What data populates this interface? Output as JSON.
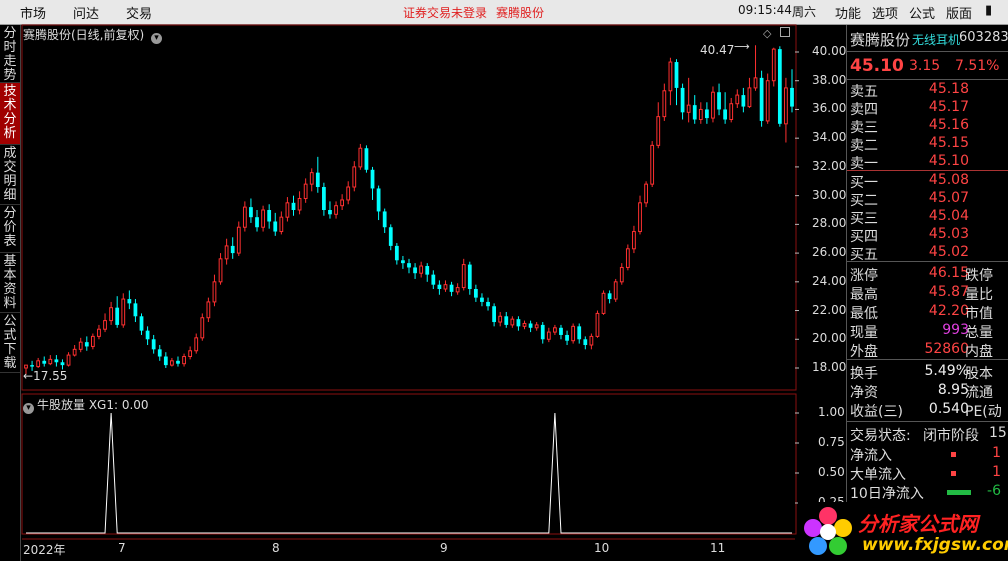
{
  "topbar": {
    "menu": [
      "市场",
      "问达",
      "交易"
    ],
    "status": "证券交易未登录",
    "stock": "赛腾股份",
    "time": "09:15:44",
    "weekday": "周六",
    "right_menu": [
      "功能",
      "选项",
      "公式",
      "版面"
    ]
  },
  "left_nav": [
    "分时走势",
    "技术分析",
    "成交明细",
    "分价表",
    "基本资料",
    "公式下载"
  ],
  "chart": {
    "title": "赛腾股份(日线,前复权)",
    "high_mark": "40.47",
    "low_mark": "←17.55",
    "price_ticks": [
      "40.00",
      "38.00",
      "36.00",
      "34.00",
      "32.00",
      "30.00",
      "28.00",
      "26.00",
      "24.00",
      "22.00",
      "20.00",
      "18.00"
    ],
    "indicator_title": "牛股放量 XG1: 0.00",
    "indicator_ticks": [
      "1.00",
      "0.75",
      "0.50",
      "0.25"
    ],
    "date_labels": [
      "2022年",
      "7",
      "8",
      "9",
      "10",
      "11"
    ]
  },
  "chart_data": {
    "type": "candlestick",
    "title": "赛腾股份(日线,前复权)",
    "ylim": [
      17,
      41
    ],
    "candles": [
      [
        18.0,
        18.2,
        18.2,
        17.55
      ],
      [
        18.2,
        18.1,
        18.5,
        17.8
      ],
      [
        18.1,
        18.5,
        18.7,
        18.0
      ],
      [
        18.5,
        18.3,
        18.8,
        18.1
      ],
      [
        18.3,
        18.6,
        18.9,
        18.2
      ],
      [
        18.6,
        18.4,
        18.9,
        18.1
      ],
      [
        18.4,
        18.2,
        18.6,
        17.9
      ],
      [
        18.2,
        18.9,
        19.1,
        18.1
      ],
      [
        18.9,
        19.3,
        19.6,
        18.8
      ],
      [
        19.3,
        19.8,
        20.1,
        19.1
      ],
      [
        19.8,
        19.5,
        20.2,
        19.2
      ],
      [
        19.5,
        20.2,
        20.4,
        19.3
      ],
      [
        20.2,
        20.7,
        21.0,
        20.0
      ],
      [
        20.7,
        21.3,
        21.8,
        20.5
      ],
      [
        21.3,
        22.2,
        22.6,
        21.0
      ],
      [
        22.2,
        21.0,
        23.0,
        20.8
      ],
      [
        21.0,
        22.8,
        23.2,
        20.8
      ],
      [
        22.8,
        22.5,
        23.4,
        22.1
      ],
      [
        22.5,
        21.6,
        22.8,
        21.2
      ],
      [
        21.6,
        20.6,
        21.8,
        20.3
      ],
      [
        20.6,
        20.0,
        20.9,
        19.6
      ],
      [
        20.0,
        19.3,
        20.3,
        19.0
      ],
      [
        19.3,
        18.8,
        19.6,
        18.5
      ],
      [
        18.8,
        18.2,
        19.1,
        18.0
      ],
      [
        18.2,
        18.5,
        18.7,
        18.1
      ],
      [
        18.5,
        18.3,
        18.8,
        18.1
      ],
      [
        18.3,
        18.8,
        19.0,
        18.1
      ],
      [
        18.8,
        19.2,
        19.5,
        18.6
      ],
      [
        19.2,
        20.1,
        20.4,
        19.0
      ],
      [
        20.1,
        21.5,
        21.8,
        19.9
      ],
      [
        21.5,
        22.6,
        22.9,
        21.2
      ],
      [
        22.6,
        24.0,
        24.5,
        22.3
      ],
      [
        24.0,
        25.6,
        26.0,
        23.8
      ],
      [
        25.6,
        26.5,
        27.0,
        25.2
      ],
      [
        26.5,
        26.0,
        27.1,
        25.6
      ],
      [
        26.0,
        27.8,
        28.2,
        25.8
      ],
      [
        27.8,
        29.2,
        29.6,
        27.5
      ],
      [
        29.2,
        28.5,
        29.8,
        28.1
      ],
      [
        28.5,
        27.8,
        29.0,
        27.5
      ],
      [
        27.8,
        29.0,
        29.3,
        27.5
      ],
      [
        29.0,
        28.2,
        29.4,
        27.7
      ],
      [
        28.2,
        27.5,
        28.8,
        27.2
      ],
      [
        27.5,
        28.5,
        28.9,
        27.3
      ],
      [
        28.5,
        29.5,
        29.9,
        28.2
      ],
      [
        29.5,
        29.0,
        30.0,
        28.6
      ],
      [
        29.0,
        29.8,
        30.3,
        28.7
      ],
      [
        29.8,
        30.8,
        31.2,
        29.5
      ],
      [
        30.8,
        31.6,
        31.9,
        30.3
      ],
      [
        31.6,
        30.6,
        32.7,
        30.2
      ],
      [
        30.6,
        29.0,
        30.9,
        28.6
      ],
      [
        29.0,
        28.7,
        29.6,
        28.4
      ],
      [
        28.7,
        29.3,
        29.6,
        28.4
      ],
      [
        29.3,
        29.7,
        30.1,
        29.0
      ],
      [
        29.7,
        30.6,
        31.0,
        29.4
      ],
      [
        30.6,
        32.0,
        32.4,
        30.3
      ],
      [
        32.0,
        33.3,
        33.6,
        31.8
      ],
      [
        33.3,
        31.8,
        33.5,
        31.6
      ],
      [
        31.8,
        30.5,
        32.0,
        29.7
      ],
      [
        30.5,
        28.9,
        30.7,
        28.3
      ],
      [
        28.9,
        27.8,
        29.1,
        27.4
      ],
      [
        27.8,
        26.5,
        28.0,
        26.2
      ],
      [
        26.5,
        25.5,
        26.7,
        25.2
      ],
      [
        25.5,
        25.3,
        25.8,
        24.9
      ],
      [
        25.3,
        25.0,
        25.6,
        24.6
      ],
      [
        25.0,
        24.6,
        25.3,
        24.2
      ],
      [
        24.6,
        25.1,
        25.4,
        24.3
      ],
      [
        25.1,
        24.5,
        25.3,
        24.0
      ],
      [
        24.5,
        23.8,
        24.8,
        23.5
      ],
      [
        23.8,
        23.5,
        24.1,
        23.1
      ],
      [
        23.5,
        23.8,
        24.1,
        23.3
      ],
      [
        23.8,
        23.3,
        24.0,
        23.0
      ],
      [
        23.3,
        23.6,
        23.9,
        23.1
      ],
      [
        23.6,
        25.2,
        25.6,
        23.4
      ],
      [
        25.2,
        23.5,
        25.4,
        23.1
      ],
      [
        23.5,
        22.9,
        23.8,
        22.6
      ],
      [
        22.9,
        22.6,
        23.2,
        22.3
      ],
      [
        22.6,
        22.3,
        22.9,
        22.0
      ],
      [
        22.3,
        21.2,
        22.5,
        20.9
      ],
      [
        21.2,
        21.6,
        21.9,
        20.9
      ],
      [
        21.6,
        21.0,
        21.9,
        20.8
      ],
      [
        21.0,
        21.4,
        21.6,
        20.8
      ],
      [
        21.4,
        20.9,
        21.6,
        20.6
      ],
      [
        20.9,
        21.1,
        21.3,
        20.7
      ],
      [
        21.1,
        20.8,
        21.3,
        20.5
      ],
      [
        20.8,
        21.0,
        21.2,
        20.6
      ],
      [
        21.0,
        20.0,
        21.2,
        19.7
      ],
      [
        20.0,
        20.5,
        20.8,
        19.8
      ],
      [
        20.5,
        20.8,
        21.0,
        20.3
      ],
      [
        20.8,
        20.3,
        21.0,
        20.0
      ],
      [
        20.3,
        19.9,
        20.6,
        19.6
      ],
      [
        19.9,
        20.9,
        21.1,
        19.7
      ],
      [
        20.9,
        20.0,
        21.1,
        19.7
      ],
      [
        20.0,
        19.6,
        20.2,
        19.3
      ],
      [
        19.6,
        20.2,
        20.4,
        19.3
      ],
      [
        20.2,
        21.8,
        22.0,
        20.1
      ],
      [
        21.8,
        23.2,
        23.4,
        21.7
      ],
      [
        23.2,
        22.8,
        23.4,
        22.5
      ],
      [
        22.8,
        24.0,
        24.2,
        22.6
      ],
      [
        24.0,
        25.0,
        25.3,
        23.8
      ],
      [
        25.0,
        26.3,
        26.6,
        24.8
      ],
      [
        26.3,
        27.5,
        27.9,
        26.0
      ],
      [
        27.5,
        29.5,
        30.0,
        27.3
      ],
      [
        29.5,
        30.8,
        31.0,
        29.2
      ],
      [
        30.8,
        33.5,
        33.8,
        30.6
      ],
      [
        33.5,
        35.5,
        36.5,
        33.3
      ],
      [
        35.5,
        37.3,
        37.8,
        35.2
      ],
      [
        37.3,
        39.3,
        39.6,
        36.3
      ],
      [
        39.3,
        37.5,
        39.5,
        36.3
      ],
      [
        37.5,
        35.8,
        37.8,
        35.3
      ],
      [
        35.8,
        36.3,
        38.2,
        35.1
      ],
      [
        36.3,
        35.3,
        37.0,
        35.0
      ],
      [
        35.3,
        36.0,
        36.5,
        35.0
      ],
      [
        36.0,
        35.4,
        36.5,
        35.0
      ],
      [
        35.4,
        37.2,
        37.6,
        35.1
      ],
      [
        37.2,
        36.0,
        37.8,
        35.6
      ],
      [
        36.0,
        35.3,
        37.2,
        35.0
      ],
      [
        35.3,
        36.4,
        36.8,
        35.1
      ],
      [
        36.4,
        37.0,
        37.4,
        36.1
      ],
      [
        37.0,
        36.2,
        37.5,
        35.8
      ],
      [
        36.2,
        37.5,
        38.2,
        36.1
      ],
      [
        37.5,
        38.2,
        40.47,
        37.3
      ],
      [
        38.2,
        35.2,
        38.7,
        34.8
      ],
      [
        35.2,
        38.0,
        38.5,
        35.0
      ],
      [
        38.0,
        40.2,
        40.3,
        37.6
      ],
      [
        40.2,
        35.0,
        40.4,
        34.8
      ],
      [
        35.0,
        37.5,
        38.2,
        33.7
      ],
      [
        37.5,
        36.2,
        38.8,
        35.8
      ]
    ],
    "indicator": {
      "name": "牛股放量",
      "series": "XG1",
      "value": "0.00",
      "ylim": [
        0,
        1.1
      ],
      "spikes_at": [
        14,
        87
      ]
    }
  },
  "quote": {
    "name": "赛腾股份",
    "tag": "无线耳机",
    "code": "603283",
    "price": "45.10",
    "change": "3.15",
    "pct": "7.51%",
    "asks": [
      {
        "label": "卖五",
        "price": "45.18"
      },
      {
        "label": "卖四",
        "price": "45.17"
      },
      {
        "label": "卖三",
        "price": "45.16"
      },
      {
        "label": "卖二",
        "price": "45.15"
      },
      {
        "label": "卖一",
        "price": "45.10"
      }
    ],
    "bids": [
      {
        "label": "买一",
        "price": "45.08"
      },
      {
        "label": "买二",
        "price": "45.07"
      },
      {
        "label": "买三",
        "price": "45.04"
      },
      {
        "label": "买四",
        "price": "45.03"
      },
      {
        "label": "买五",
        "price": "45.02"
      }
    ],
    "stats": [
      {
        "label": "涨停",
        "value": "46.15",
        "color": "#ff4444",
        "label2": "跌停"
      },
      {
        "label": "最高",
        "value": "45.87",
        "color": "#ff4444",
        "label2": "量比"
      },
      {
        "label": "最低",
        "value": "42.20",
        "color": "#ff4444",
        "label2": "市值"
      },
      {
        "label": "现量",
        "value": "993",
        "color": "#e040e0",
        "label2": "总量"
      },
      {
        "label": "外盘",
        "value": "52860",
        "color": "#ff4444",
        "label2": "内盘"
      }
    ],
    "stats2": [
      {
        "label": "换手",
        "value": "5.49%",
        "color": "#eeeeee",
        "label2": "股本"
      },
      {
        "label": "净资",
        "value": "8.95",
        "color": "#eeeeee",
        "label2": "流通"
      },
      {
        "label": "收益(三)",
        "value": "0.540",
        "color": "#eeeeee",
        "label2": "PE(动"
      }
    ],
    "trade_state_label": "交易状态:",
    "trade_state_value": "闭市阶段",
    "trade_state_num": "15",
    "flows": [
      {
        "label": "净流入",
        "value": "1",
        "color": "#ff4444"
      },
      {
        "label": "大单流入",
        "value": "1",
        "color": "#ff4444"
      },
      {
        "label": "10日净流入",
        "value": "-6",
        "color": "#22bb44"
      }
    ]
  },
  "watermark": {
    "brand": "分析家公式网",
    "url": "www.fxjgsw.com"
  },
  "colors": {
    "up": "#ff3030",
    "down": "#00ffff",
    "bg": "#000000",
    "grid": "#8a1010"
  }
}
